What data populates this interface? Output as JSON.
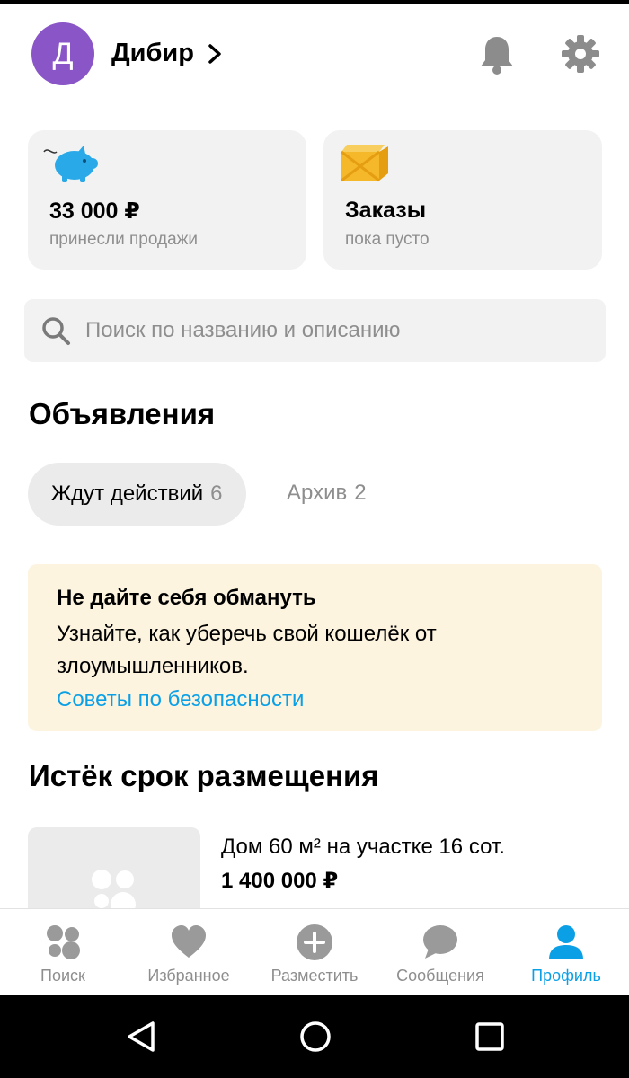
{
  "header": {
    "avatar_letter": "Д",
    "user_name": "Дибир",
    "icons": {
      "notifications": "bell-icon",
      "settings": "gear-icon"
    }
  },
  "cards": {
    "sales": {
      "title": "33 000 ₽",
      "subtitle": "принесли продажи",
      "icon": "piggy-bank-icon"
    },
    "orders": {
      "title": "Заказы",
      "subtitle": "пока пусто",
      "icon": "box-icon"
    }
  },
  "search": {
    "placeholder": "Поиск по названию и описанию",
    "value": ""
  },
  "ads": {
    "title": "Объявления",
    "tabs": [
      {
        "label": "Ждут действий",
        "count": "6",
        "active": true
      },
      {
        "label": "Архив",
        "count": "2",
        "active": false
      }
    ]
  },
  "warning": {
    "title": "Не дайте себя обмануть",
    "text": "Узнайте, как уберечь свой кошелёк от злоумышленников.",
    "link": "Советы по безопасности"
  },
  "expired": {
    "title": "Истёк срок размещения",
    "items": [
      {
        "title": "Дом 60 м² на участке 16 сот.",
        "price": "1 400 000 ₽"
      }
    ]
  },
  "bottom_nav": [
    {
      "label": "Поиск",
      "icon": "dots-search-icon",
      "active": false
    },
    {
      "label": "Избранное",
      "icon": "heart-icon",
      "active": false
    },
    {
      "label": "Разместить",
      "icon": "plus-circle-icon",
      "active": false
    },
    {
      "label": "Сообщения",
      "icon": "chat-bubble-icon",
      "active": false
    },
    {
      "label": "Профиль",
      "icon": "person-icon",
      "active": true
    }
  ],
  "colors": {
    "accent": "#0ba0e6",
    "avatar": "#8a55c7",
    "card_bg": "#f2f2f2",
    "warning_bg": "#fdf4e0",
    "muted_text": "#8e8e8e"
  }
}
